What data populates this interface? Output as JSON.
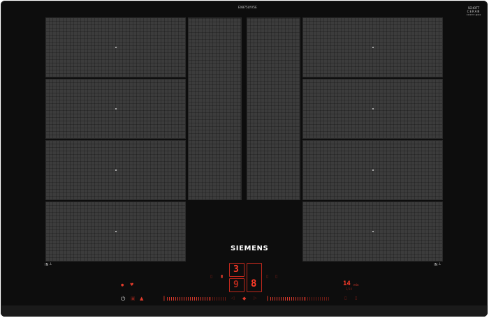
{
  "top_label": "EX875LYV5E",
  "brand": "SIEMENS",
  "ceran_logo": {
    "line1": "SCHOTT",
    "line2": "CERAN",
    "line3": "ceramic glass"
  },
  "left_label": "IN",
  "right_label": "IN",
  "display": {
    "level_top": "3",
    "level_bottom": "9",
    "level_main": "8",
    "timer": "14",
    "timer_unit": "min",
    "timer_sub": "1/10"
  },
  "icons": {
    "power": "power-icon",
    "lock": "child-lock-icon",
    "vent": "vent-icon",
    "flame": "boost-icon",
    "heart": "favourite-icon"
  },
  "colors": {
    "glass": "#0d0d0d",
    "zone": "#3c3c3c",
    "led": "#e03a2a"
  }
}
